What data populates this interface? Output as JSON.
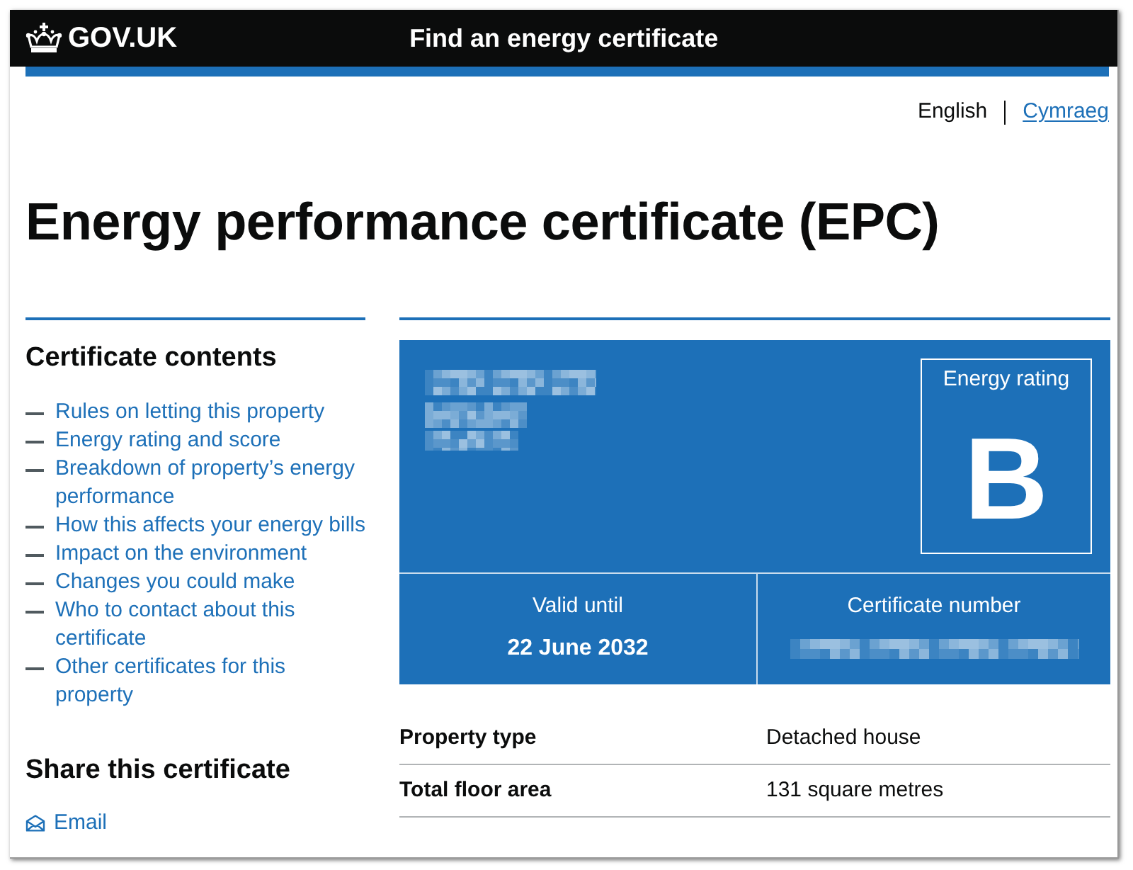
{
  "header": {
    "logo": "GOV.UK",
    "service_name": "Find an energy certificate"
  },
  "language_switch": [
    {
      "label": "English",
      "selected": true
    },
    {
      "label": "Cymraeg",
      "selected": false
    }
  ],
  "heading": "Energy performance certificate (EPC)",
  "sidebar": {
    "title": "Certificate contents",
    "items": [
      "Rules on letting this property",
      "Energy rating and score",
      "Breakdown of property’s energy performance",
      "How this affects your energy bills",
      "Impact on the environment",
      "Changes you could make",
      "Who to contact about this certificate",
      "Other certificates for this property"
    ],
    "share_title": "Share this certificate",
    "share_links": [
      {
        "label": "Email"
      }
    ]
  },
  "certificate": {
    "rating_label": "Energy rating",
    "rating": "B",
    "valid_until_label": "Valid until",
    "valid_until": "22 June 2032",
    "number_label": "Certificate number"
  },
  "summary": [
    {
      "label": "Property type",
      "value": "Detached house"
    },
    {
      "label": "Total floor area",
      "value": "131 square metres"
    }
  ]
}
